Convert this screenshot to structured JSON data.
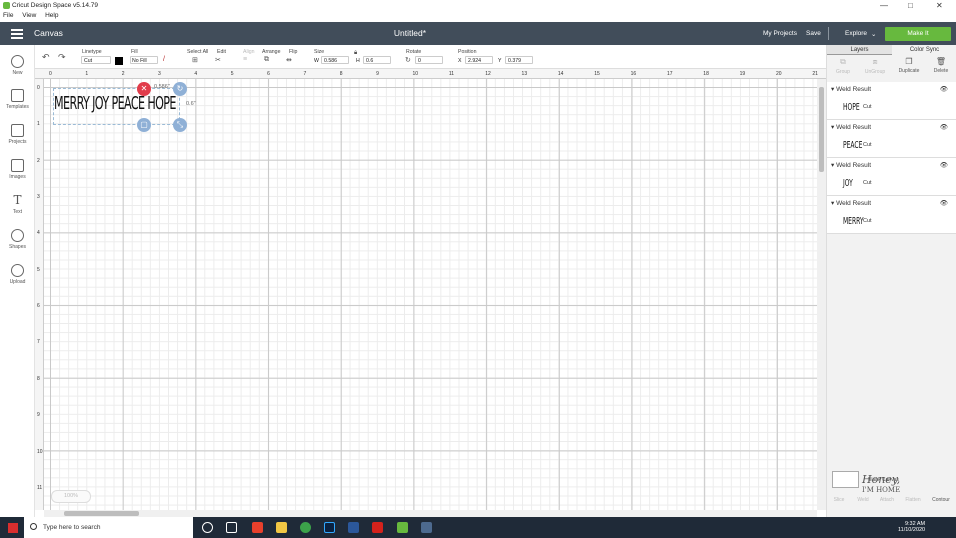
{
  "window": {
    "title": "Cricut Design Space  v5.14.79",
    "minimize": "—",
    "maximize": "□",
    "close": "✕"
  },
  "menu": [
    "File",
    "View",
    "Help"
  ],
  "header": {
    "section": "Canvas",
    "doc_title": "Untitled*",
    "my_projects": "My Projects",
    "save": "Save",
    "explore": "Explore",
    "make_it": "Make It"
  },
  "toolbar": {
    "linetype_label": "Linetype",
    "linetype_value": "Cut",
    "fill_label": "Fill",
    "fill_value": "No Fill",
    "select_all": "Select All",
    "edit": "Edit",
    "align": "Align",
    "arrange": "Arrange",
    "flip": "Flip",
    "size_label": "Size",
    "w_label": "W",
    "w_value": "0.586",
    "h_label": "H",
    "h_value": "0.6",
    "rotate_label": "Rotate",
    "rotate_value": "0",
    "position_label": "Position",
    "x_label": "X",
    "x_value": "2.924",
    "y_label": "Y",
    "y_value": "0.379"
  },
  "leftbar": [
    {
      "label": "New",
      "icon": "plus-icon"
    },
    {
      "label": "Templates",
      "icon": "shirt-icon"
    },
    {
      "label": "Projects",
      "icon": "projects-icon"
    },
    {
      "label": "Images",
      "icon": "image-icon"
    },
    {
      "label": "Text",
      "icon": "text-icon"
    },
    {
      "label": "Shapes",
      "icon": "shapes-icon"
    },
    {
      "label": "Upload",
      "icon": "upload-icon"
    }
  ],
  "ruler": {
    "top": [
      "0",
      "1",
      "2",
      "3",
      "4",
      "5",
      "6",
      "7",
      "8",
      "9",
      "10",
      "11",
      "12",
      "13",
      "14",
      "15",
      "16",
      "17",
      "18",
      "19",
      "20",
      "21"
    ],
    "left": [
      "0",
      "1",
      "2",
      "3",
      "4",
      "5",
      "6",
      "7",
      "8",
      "9",
      "10",
      "11"
    ]
  },
  "canvas": {
    "design_text": "MERRY JOY PEACE HOPE",
    "width_label": "0.586\"",
    "height_label": "0.6\"",
    "zoom": "100%"
  },
  "panel": {
    "tabs": [
      "Layers",
      "Color Sync"
    ],
    "actions": [
      "Group",
      "UnGroup",
      "Duplicate",
      "Delete"
    ],
    "layers": [
      {
        "title": "Weld Result",
        "thumb": "HOPE",
        "op": "Cut"
      },
      {
        "title": "Weld Result",
        "thumb": "PEACE",
        "op": "Cut"
      },
      {
        "title": "Weld Result",
        "thumb": "JOY",
        "op": "Cut"
      },
      {
        "title": "Weld Result",
        "thumb": "MERRY",
        "op": "Cut"
      }
    ],
    "blank_canvas": "Blank Canvas",
    "bottom_actions": [
      "Slice",
      "Weld",
      "Attach",
      "Flatten",
      "Contour"
    ]
  },
  "watermark": {
    "line1": "Honey,",
    "line2": "I'M HOME"
  },
  "taskbar": {
    "search_placeholder": "Type here to search",
    "time": "9:32 AM",
    "date": "11/10/2020"
  },
  "colors": {
    "header": "#414d5a",
    "make_it": "#67b93e",
    "delete_handle": "#e13c4b",
    "handle": "#8fb0d6"
  }
}
